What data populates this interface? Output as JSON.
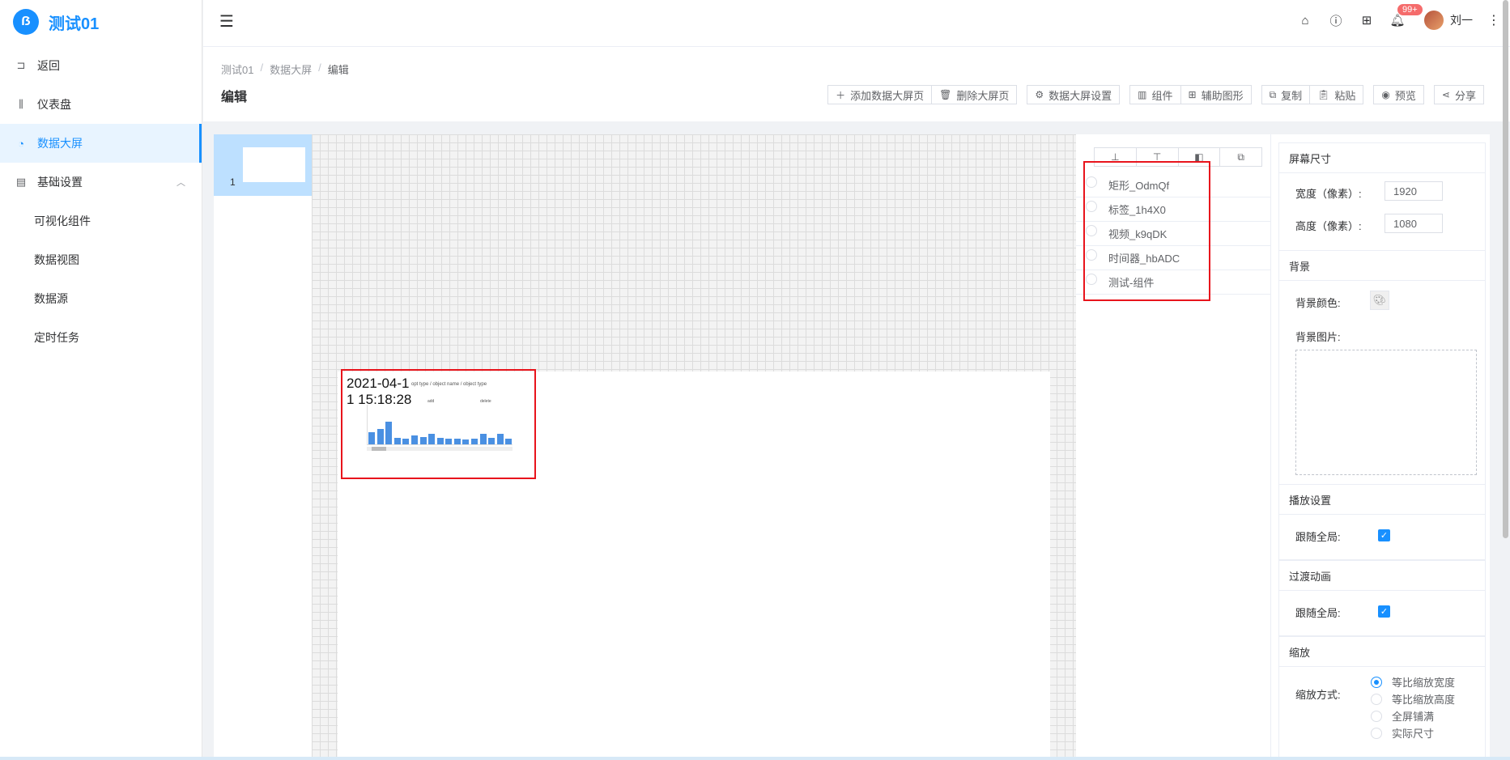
{
  "sidebar": {
    "logo_glyph": "ẞ",
    "app_title": "测试01",
    "items": [
      {
        "label": "返回",
        "icon": "back-icon"
      },
      {
        "label": "仪表盘",
        "icon": "dashboard-icon"
      },
      {
        "label": "数据大屏",
        "icon": "pie-chart-icon",
        "active": true
      },
      {
        "label": "基础设置",
        "icon": "settings-doc-icon",
        "expanded": true
      }
    ],
    "sub_items": [
      "可视化组件",
      "数据视图",
      "数据源",
      "定时任务"
    ]
  },
  "topbar": {
    "notification_badge": "99+",
    "user_name": "刘一"
  },
  "breadcrumb": [
    "测试01",
    "数据大屏",
    "编辑"
  ],
  "page_title": "编辑",
  "toolbar": {
    "add_page": "添加数据大屏页",
    "delete_page": "删除大屏页",
    "screen_settings": "数据大屏设置",
    "component": "组件",
    "aux_shape": "辅助图形",
    "copy": "复制",
    "paste": "粘贴",
    "preview": "预览",
    "share": "分享"
  },
  "pages": [
    {
      "number": "1"
    }
  ],
  "widget": {
    "time_line1": "2021-04-1",
    "time_line2": "1 15:18:28",
    "chart_title": "opt type / object name / object type",
    "label_add": "add",
    "label_delete": "delete",
    "chart_values": [
      0.3,
      0.38,
      0.55,
      0.15,
      0.13,
      0.22,
      0.18,
      0.25,
      0.15,
      0.14,
      0.14,
      0.12,
      0.13,
      0.26,
      0.15,
      0.26,
      0.14
    ]
  },
  "layers": [
    "矩形_OdmQf",
    "标签_1h4X0",
    "视频_k9qDK",
    "时间器_hbADC",
    "测试-组件"
  ],
  "settings": {
    "screen_size": {
      "title": "屏幕尺寸",
      "width_label": "宽度（像素）:",
      "width_value": "1920",
      "height_label": "高度（像素）:",
      "height_value": "1080"
    },
    "background": {
      "title": "背景",
      "color_label": "背景颜色:",
      "image_label": "背景图片:"
    },
    "playback": {
      "title": "播放设置",
      "follow_label": "跟随全局:",
      "follow_checked": true
    },
    "transition": {
      "title": "过渡动画",
      "follow_label": "跟随全局:",
      "follow_checked": true
    },
    "scale": {
      "title": "缩放",
      "mode_label": "缩放方式:",
      "options": [
        "等比缩放宽度",
        "等比缩放高度",
        "全屏铺满",
        "实际尺寸"
      ],
      "selected": 0
    }
  }
}
